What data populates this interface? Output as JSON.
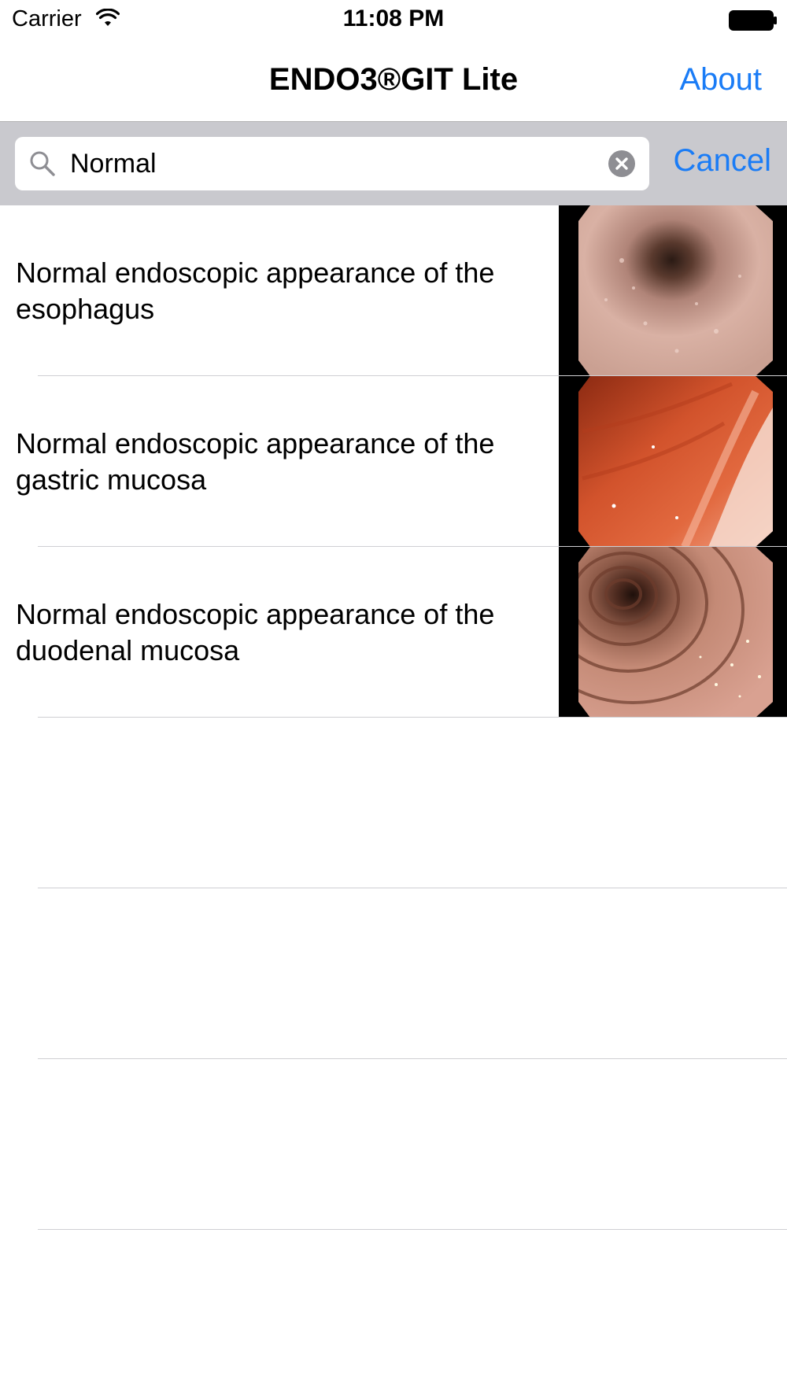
{
  "status_bar": {
    "carrier": "Carrier",
    "time": "11:08 PM",
    "wifi_icon": "wifi-icon",
    "battery_icon": "battery-icon"
  },
  "nav": {
    "title": "ENDO3®GIT Lite",
    "about_label": "About"
  },
  "search": {
    "value": "Normal",
    "cancel_label": "Cancel",
    "search_icon": "search-icon",
    "clear_icon": "clear-icon"
  },
  "results": [
    {
      "line1": "Normal endoscopic appearance of the",
      "line2": "esophagus",
      "thumbnail": "esophagus-endoscopy-thumbnail"
    },
    {
      "line1": "Normal endoscopic appearance of the",
      "line2": "gastric mucosa",
      "thumbnail": "gastric-mucosa-endoscopy-thumbnail"
    },
    {
      "line1": "Normal endoscopic appearance of the",
      "line2": "duodenal mucosa",
      "thumbnail": "duodenal-mucosa-endoscopy-thumbnail"
    }
  ],
  "colors": {
    "accent": "#1a7cf6",
    "search_bar_bg": "#c9c9ce",
    "separator": "#cfcfd3"
  }
}
